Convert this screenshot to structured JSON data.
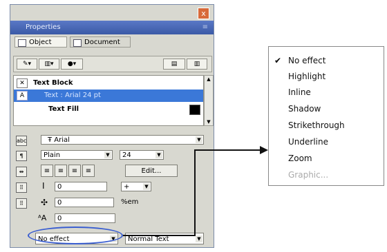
{
  "window": {
    "title": "Properties",
    "close_glyph": "x",
    "pin_glyph": "≡"
  },
  "tabs": [
    {
      "label": "Object"
    },
    {
      "label": "Document"
    }
  ],
  "toolbar": {
    "icons": [
      "pencil-icon",
      "fill-icon",
      "effect-icon"
    ]
  },
  "object_list": [
    {
      "label": "Text Block",
      "selected": false
    },
    {
      "label": "Text : Arial 24 pt",
      "selected": true
    },
    {
      "label": "Text Fill",
      "selected": false,
      "swatch": "#000000"
    }
  ],
  "text_props": {
    "font_label": "abc",
    "font": "Arial",
    "style": "Plain",
    "size": "24",
    "edit_label": "Edit...",
    "field_1": "0",
    "field_2": "0",
    "field_3": "0",
    "field_2_unit": "%em",
    "small_select": "+",
    "effect_select": "No effect",
    "mode_select": "Normal Text"
  },
  "effect_menu": {
    "items": [
      {
        "label": "No effect",
        "checked": true,
        "enabled": true
      },
      {
        "label": "Highlight",
        "checked": false,
        "enabled": true
      },
      {
        "label": "Inline",
        "checked": false,
        "enabled": true
      },
      {
        "label": "Shadow",
        "checked": false,
        "enabled": true
      },
      {
        "label": "Strikethrough",
        "checked": false,
        "enabled": true
      },
      {
        "label": "Underline",
        "checked": false,
        "enabled": true
      },
      {
        "label": "Zoom",
        "checked": false,
        "enabled": true
      },
      {
        "label": "Graphic...",
        "checked": false,
        "enabled": false
      }
    ],
    "check_glyph": "✔"
  },
  "colors": {
    "accent": "#3b78d8",
    "callout": "#3a5ed0",
    "title_bar": "#4a68b6"
  }
}
